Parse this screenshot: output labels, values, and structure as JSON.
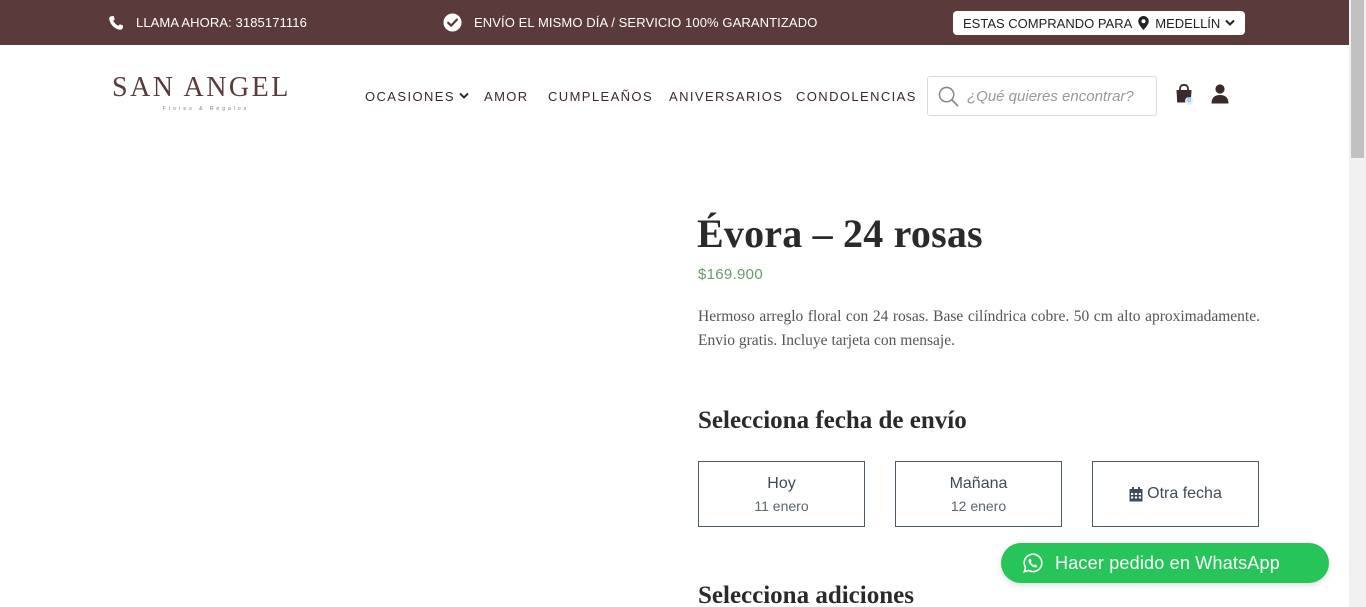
{
  "topbar": {
    "phone_text": "LLAMA AHORA: 3185171116",
    "guarantee_text": "ENVÍO EL MISMO DÍA / SERVICIO 100% GARANTIZADO",
    "location_prefix": "ESTAS COMPRANDO PARA",
    "location_city": "MEDELLÍN",
    "bg_color": "#5a3a3a"
  },
  "logo": {
    "brand": "SAN ANGEL",
    "tagline": "Flores & Regalos"
  },
  "nav": {
    "items": [
      {
        "label": "OCASIONES",
        "has_dropdown": true
      },
      {
        "label": "AMOR"
      },
      {
        "label": "CUMPLEAÑOS"
      },
      {
        "label": "ANIVERSARIOS"
      },
      {
        "label": "CONDOLENCIAS"
      }
    ]
  },
  "search": {
    "placeholder": "¿Qué quieres encontrar?",
    "value": ""
  },
  "cart": {
    "count": "0"
  },
  "product": {
    "title": "Évora – 24 rosas",
    "price": "$169.900",
    "description": "Hermoso arreglo floral con 24 rosas. Base cilíndrica cobre. 50 cm alto aproximadamente. Envio gratis. Incluye tarjeta con mensaje."
  },
  "delivery": {
    "heading": "Selecciona fecha de envío",
    "options": [
      {
        "label": "Hoy",
        "date": "11 enero"
      },
      {
        "label": "Mañana",
        "date": "12 enero"
      },
      {
        "label": "Otra fecha",
        "icon": "calendar-icon"
      }
    ]
  },
  "addons": {
    "heading": "Selecciona adiciones"
  },
  "whatsapp": {
    "label": "Hacer pedido en WhatsApp",
    "color": "#27c45a"
  }
}
